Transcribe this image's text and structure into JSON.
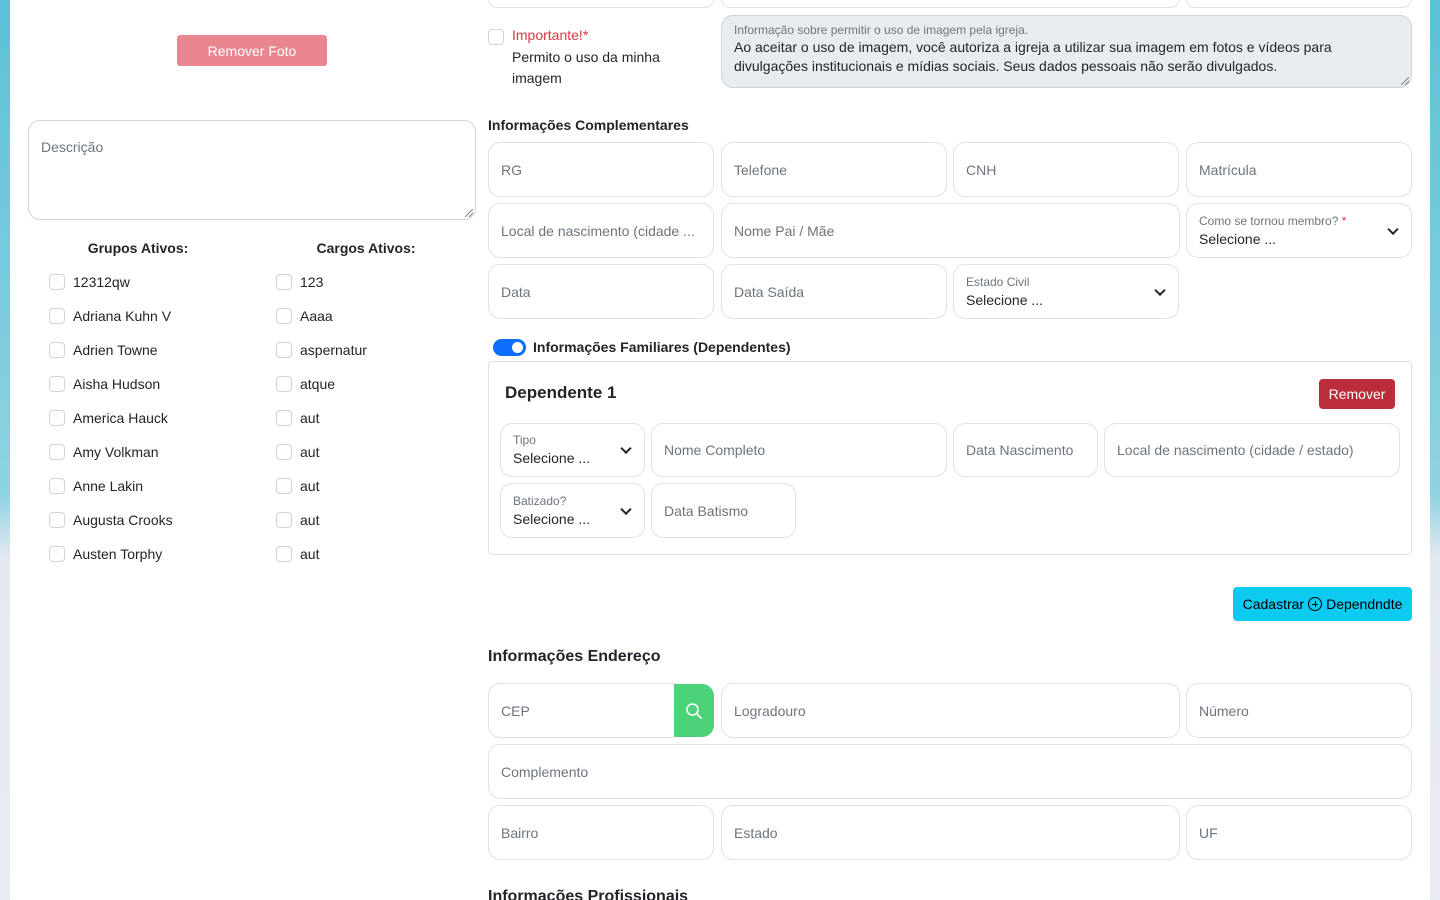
{
  "photo": {
    "remove_label": "Remover Foto"
  },
  "descricao": {
    "placeholder": "Descrição"
  },
  "grupos": {
    "title": "Grupos Ativos:",
    "items": [
      "12312qw",
      "Adriana Kuhn V",
      "Adrien Towne",
      "Aisha Hudson",
      "America Hauck",
      "Amy Volkman",
      "Anne Lakin",
      "Augusta Crooks",
      "Austen Torphy"
    ]
  },
  "cargos": {
    "title": "Cargos Ativos:",
    "items": [
      "123",
      "Aaaa",
      "aspernatur",
      "atque",
      "aut",
      "aut",
      "aut",
      "aut",
      "aut"
    ]
  },
  "imagem": {
    "important_label": "Importante!*",
    "consent_text": "Permito o uso da minha imagem",
    "info_label": "Informação sobre permitir o uso de imagem pela igreja.",
    "info_text": "Ao aceitar o uso de imagem, você autoriza a igreja a utilizar sua imagem em fotos e vídeos para divulgações institucionais e mídias sociais. Seus dados pessoais não serão divulgados."
  },
  "complementares": {
    "title": "Informações Complementares",
    "rg": "RG",
    "telefone": "Telefone",
    "cnh": "CNH",
    "matricula": "Matrícula",
    "local_nascimento": "Local de nascimento (cidade ...",
    "nome_pai_mae": "Nome Pai / Mãe",
    "como_membro_label": "Como se tornou membro?",
    "required_mark": "*",
    "select_value": "Selecione ...",
    "data": "Data",
    "data_saida": "Data Saída",
    "estado_civil_label": "Estado Civil"
  },
  "familiares": {
    "title": "Informações Familiares (Dependentes)",
    "toggle_on": true,
    "dependente_title": "Dependente 1",
    "remover": "Remover",
    "tipo_label": "Tipo",
    "select_value": "Selecione ...",
    "nome_completo": "Nome Completo",
    "data_nascimento": "Data Nascimento",
    "local_nascimento": "Local de nascimento (cidade / estado)",
    "batizado_label": "Batizado?",
    "data_batismo": "Data Batismo",
    "cadastrar_pre": "Cadastrar",
    "cadastrar_post": "Dependndte"
  },
  "endereco": {
    "title": "Informações Endereço",
    "cep": "CEP",
    "logradouro": "Logradouro",
    "numero": "Número",
    "complemento": "Complemento",
    "bairro": "Bairro",
    "estado": "Estado",
    "uf": "UF"
  },
  "next_section": {
    "title": "Informações Profissionais"
  },
  "colors": {
    "primary": "#0d6efd",
    "danger": "#bb2d3b",
    "info": "#0dcaf0",
    "success": "#4cd279",
    "remove_photo": "#ea868f"
  }
}
